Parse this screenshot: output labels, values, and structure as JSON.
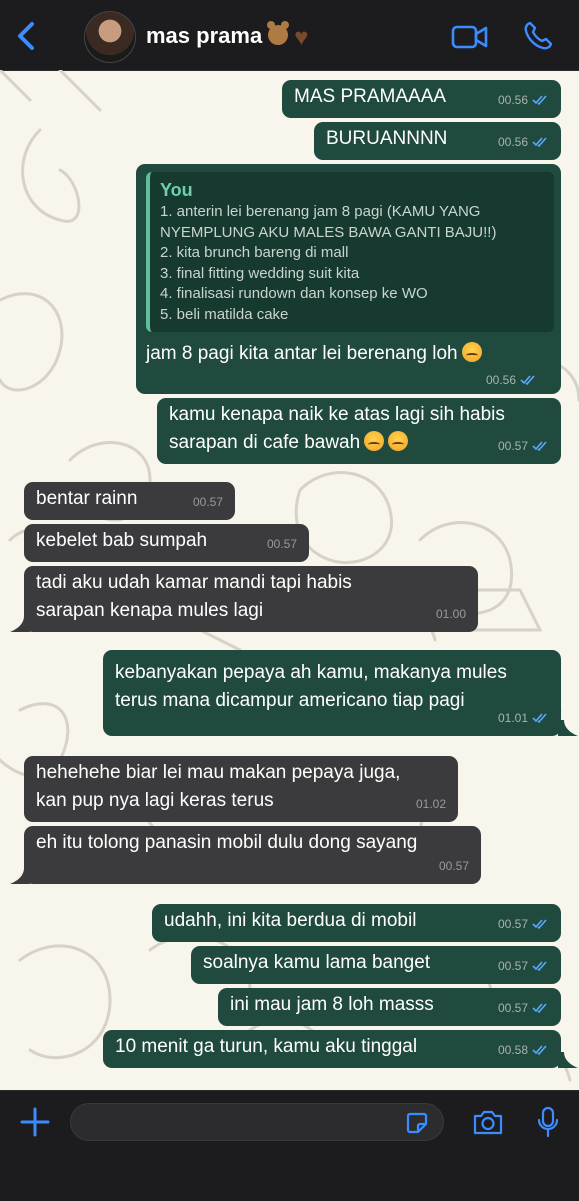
{
  "header": {
    "contact_name": "mas prama",
    "icons": [
      "back-chevron-icon",
      "teddy-bear-icon",
      "brown-heart-icon",
      "video-camera-icon",
      "phone-icon"
    ]
  },
  "colors": {
    "accent": "#3d8cff",
    "outgoing_bubble": "#1f4a3d",
    "incoming_bubble": "#3b3b3d",
    "wallpaper": "#f7f5ec",
    "quote_author": "#6ed0ab"
  },
  "messages": [
    {
      "dir": "out",
      "text": "MAS PRAMAAAA",
      "time": "00.56"
    },
    {
      "dir": "out",
      "text": "BURUANNNN",
      "time": "00.56"
    },
    {
      "dir": "out",
      "reply": {
        "author": "You",
        "lines": [
          "1. anterin lei berenang jam 8 pagi (KAMU YANG",
          "NYEMPLUNG AKU MALES BAWA GANTI BAJU!!)",
          "2. kita brunch bareng di mall",
          "3. final fitting wedding suit kita",
          "4. finalisasi rundown dan konsep ke WO",
          "5. beli matilda cake"
        ]
      },
      "text": "jam 8 pagi kita antar lei berenang loh",
      "emoji": "angry-face",
      "time": "00.56"
    },
    {
      "dir": "out",
      "lines": [
        "kamu kenapa naik ke atas lagi sih habis",
        "sarapan di cafe bawah"
      ],
      "emoji": "angry-face angry-face",
      "time": "00.57"
    },
    {
      "dir": "in",
      "text": "bentar rainn",
      "time": "00.57"
    },
    {
      "dir": "in",
      "text": "kebelet bab sumpah",
      "time": "00.57"
    },
    {
      "dir": "in",
      "lines": [
        "tadi aku udah kamar mandi tapi habis",
        "sarapan kenapa mules lagi"
      ],
      "time": "01.00"
    },
    {
      "dir": "out",
      "lines": [
        "kebanyakan pepaya ah kamu, makanya mules",
        "terus mana dicampur americano tiap pagi"
      ],
      "time": "01.01"
    },
    {
      "dir": "in",
      "lines": [
        "hehehehe biar lei mau makan pepaya juga,",
        "kan pup nya lagi keras terus"
      ],
      "time": "01.02"
    },
    {
      "dir": "in",
      "text": "eh itu tolong panasin mobil dulu dong sayang",
      "time": "00.57"
    },
    {
      "dir": "out",
      "text": "udahh, ini kita berdua di mobil",
      "time": "00.57"
    },
    {
      "dir": "out",
      "text": "soalnya kamu lama banget",
      "time": "00.57"
    },
    {
      "dir": "out",
      "text": "ini mau jam 8 loh masss",
      "time": "00.57"
    },
    {
      "dir": "out",
      "text": "10 menit ga turun, kamu aku tinggal",
      "time": "00.58"
    }
  ],
  "composer": {
    "value": "",
    "icons": [
      "plus-icon",
      "sticker-icon",
      "camera-icon",
      "microphone-icon"
    ]
  }
}
